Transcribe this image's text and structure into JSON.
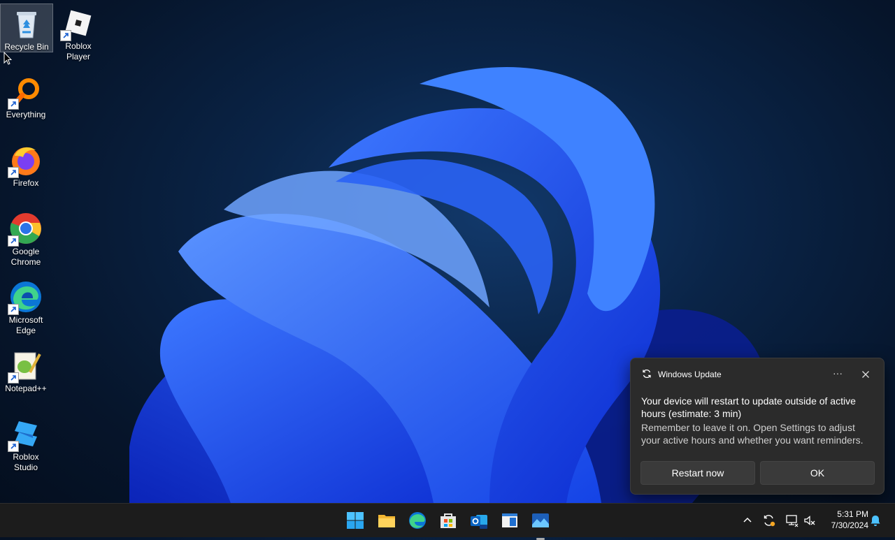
{
  "desktop": {
    "icons": [
      {
        "name": "recycle-bin",
        "label": "Recycle Bin",
        "icon": "recycle-bin-icon"
      },
      {
        "name": "roblox-player",
        "label": "Roblox Player",
        "icon": "roblox-player-icon"
      },
      {
        "name": "everything",
        "label": "Everything",
        "icon": "everything-icon"
      },
      {
        "name": "firefox",
        "label": "Firefox",
        "icon": "firefox-icon"
      },
      {
        "name": "google-chrome",
        "label": "Google Chrome",
        "icon": "chrome-icon"
      },
      {
        "name": "microsoft-edge",
        "label": "Microsoft Edge",
        "icon": "edge-icon"
      },
      {
        "name": "notepad-plus-plus",
        "label": "Notepad++",
        "icon": "notepad-plus-plus-icon"
      },
      {
        "name": "roblox-studio",
        "label": "Roblox Studio",
        "icon": "roblox-studio-icon"
      }
    ]
  },
  "notification": {
    "app_name": "Windows Update",
    "more_label": "···",
    "title": "Your device will restart to update outside of active hours (estimate: 3 min)",
    "body": "Remember to leave it on. Open Settings to adjust your active hours and whether you want reminders.",
    "primary_button": "Restart now",
    "secondary_button": "OK"
  },
  "taskbar": {
    "apps": [
      "start-icon",
      "file-explorer-icon",
      "edge-icon",
      "microsoft-store-icon",
      "outlook-icon",
      "notepad-icon",
      "photos-icon"
    ],
    "tray": [
      "chevron-up-icon",
      "update-icon",
      "network-icon",
      "speaker-muted-icon",
      "notification-bell-icon"
    ]
  },
  "clock": {
    "time": "5:31 PM",
    "date": "7/30/2024"
  },
  "colors": {
    "accent": "#1f5cff",
    "taskbar_bg": "#1c1c1c",
    "toast_bg": "#2b2b2b"
  }
}
